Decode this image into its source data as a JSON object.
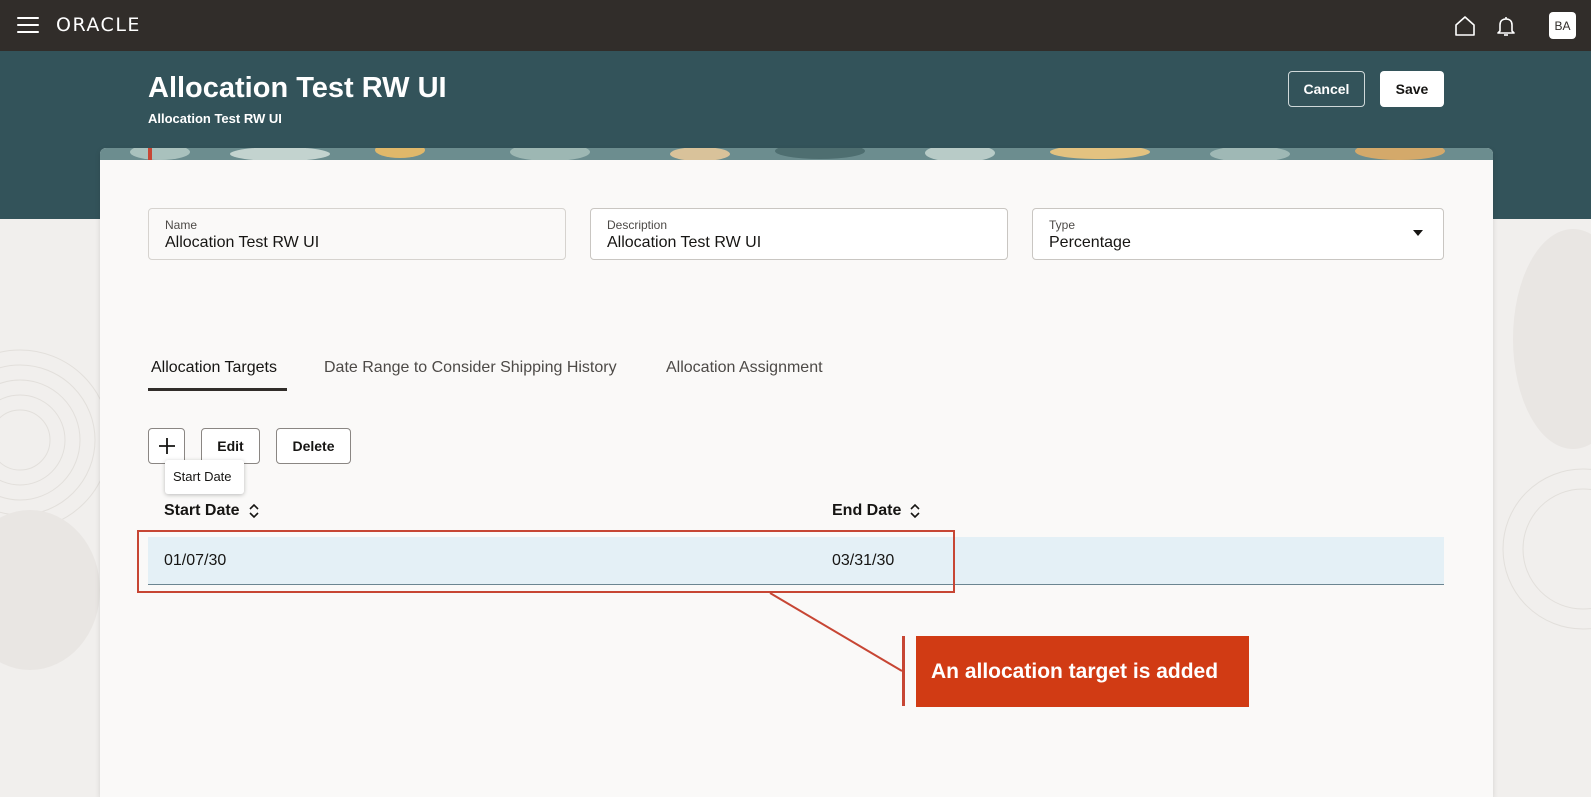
{
  "topbar": {
    "logo": "ORACLE",
    "avatar_initials": "BA",
    "menu_icon": "hamburger-icon",
    "home_icon": "home-icon",
    "notifications_icon": "bell-icon"
  },
  "header": {
    "title": "Allocation Test RW UI",
    "subtitle": "Allocation Test RW UI",
    "cancel_label": "Cancel",
    "save_label": "Save"
  },
  "form": {
    "name": {
      "label": "Name",
      "value": "Allocation Test RW UI"
    },
    "description": {
      "label": "Description",
      "value": "Allocation Test RW UI"
    },
    "type": {
      "label": "Type",
      "value": "Percentage"
    }
  },
  "tabs": [
    {
      "label": "Allocation Targets",
      "active": true
    },
    {
      "label": "Date Range to Consider Shipping History",
      "active": false
    },
    {
      "label": "Allocation Assignment",
      "active": false
    }
  ],
  "toolbar": {
    "add_icon": "plus-icon",
    "edit_label": "Edit",
    "delete_label": "Delete",
    "tooltip": "Start Date"
  },
  "table": {
    "columns": [
      "Start Date",
      "End Date"
    ],
    "rows": [
      [
        "01/07/30",
        "03/31/30"
      ]
    ]
  },
  "annotation": {
    "callout_text": "An allocation target is added"
  },
  "colors": {
    "topbar": "#312d2a",
    "banner": "#33535a",
    "callout": "#d13b14",
    "highlight": "#c74634",
    "selected_row": "#e4f0f6"
  }
}
